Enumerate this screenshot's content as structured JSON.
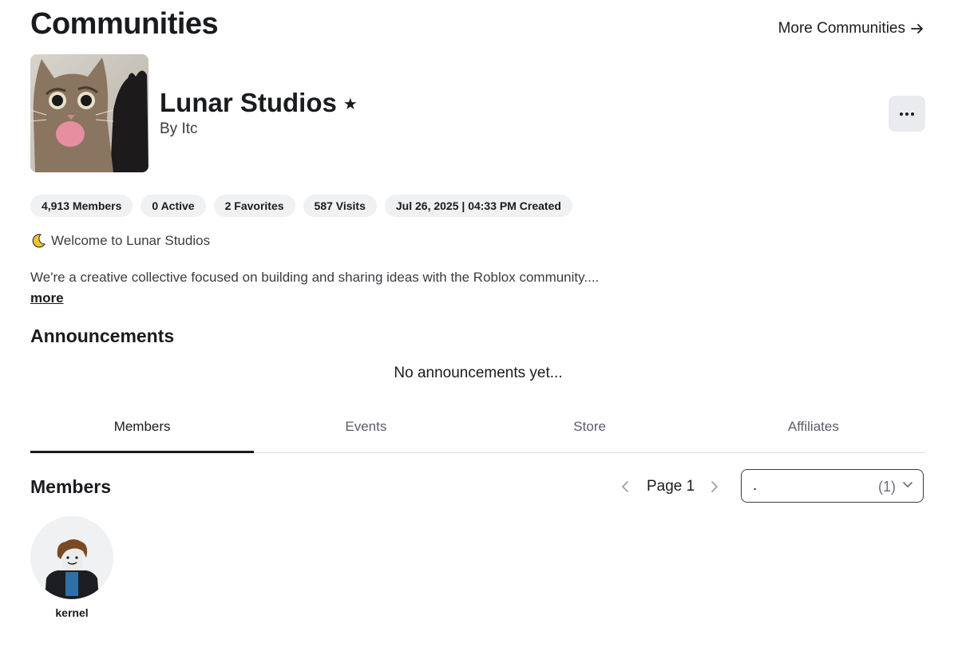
{
  "header": {
    "title": "Communities",
    "more_communities": "More Communities"
  },
  "group": {
    "name": "Lunar Studios",
    "owner": "By Itc",
    "stats": [
      "4,913 Members",
      "0 Active",
      "2 Favorites",
      "587 Visits",
      "Jul 26, 2025 | 04:33 PM Created"
    ],
    "welcome": "Welcome to Lunar Studios",
    "description": "We're a creative collective focused on building and sharing ideas with the Roblox community....",
    "more_link": "more"
  },
  "announcements": {
    "heading": "Announcements",
    "empty_text": "No announcements yet..."
  },
  "tabs": [
    {
      "label": "Members",
      "active": true
    },
    {
      "label": "Events",
      "active": false
    },
    {
      "label": "Store",
      "active": false
    },
    {
      "label": "Affiliates",
      "active": false
    }
  ],
  "members": {
    "heading": "Members",
    "page_label": "Page 1",
    "role_select": {
      "value": ".",
      "count": "(1)"
    },
    "list": [
      {
        "name": "kernel"
      }
    ]
  },
  "icons": {
    "header_link": "arrow-right-icon",
    "group_name": "star-icon",
    "more_actions": "more-horizontal-icon",
    "welcome": "moon-icon",
    "pager_prev": "chevron-left-icon",
    "pager_next": "chevron-right-icon",
    "select": "chevron-down-icon"
  }
}
